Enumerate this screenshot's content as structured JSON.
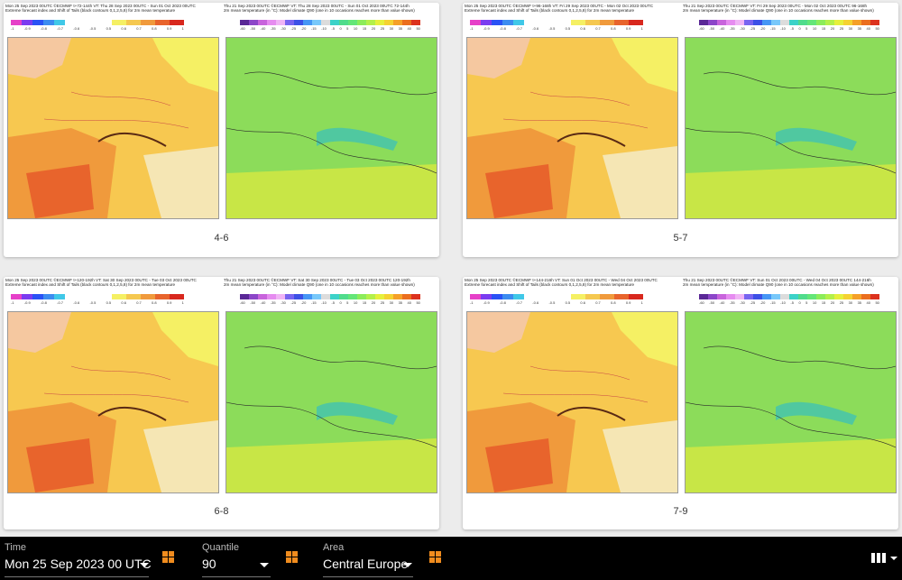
{
  "cards": [
    {
      "caption": "4-6",
      "left_header": "Mon 25 Sep 2023 00UTC ©ECMWF t+72-144h  VT: Thu 28 Sep 2023 00UTC - Sun 01 Oct 2023 00UTC\nExtreme forecast index and Shift of Tails (black contours 0,1,2,5,8) for 2m mean temperature",
      "right_header": "Thu 21 Sep 2023 00UTC ©ECMWF  VT: Thu 28 Sep 2023 00UTC - Sun 01 Oct 2023 00UTC   72-144h\n2m mean temperature (in °C): Model climate Q90 (one in 10 occasions reaches more than value shown)"
    },
    {
      "caption": "5-7",
      "left_header": "Mon 25 Sep 2023 00UTC ©ECMWF t+96-168h  VT: Fri 29 Sep 2023 00UTC - Mon 02 Oct 2023 00UTC\nExtreme forecast index and Shift of Tails (black contours 0,1,2,5,8) for 2m mean temperature",
      "right_header": "Thu 21 Sep 2023 00UTC ©ECMWF  VT: Fri 29 Sep 2023 00UTC - Mon 02 Oct 2023 00UTC   96-168h\n2m mean temperature (in °C): Model climate Q90 (one in 10 occasions reaches more than value shown)"
    },
    {
      "caption": "6-8",
      "left_header": "Mon 25 Sep 2023 00UTC ©ECMWF t+120-192h  VT: Sat 30 Sep 2023 00UTC - Tue 03 Oct 2023 00UTC\nExtreme forecast index and Shift of Tails (black contours 0,1,2,5,8) for 2m mean temperature",
      "right_header": "Thu 21 Sep 2023 00UTC ©ECMWF  VT: Sat 30 Sep 2023 00UTC - Tue 03 Oct 2023 00UTC   120-192h\n2m mean temperature (in °C): Model climate Q90 (one in 10 occasions reaches more than value shown)"
    },
    {
      "caption": "7-9",
      "left_header": "Mon 25 Sep 2023 00UTC ©ECMWF t+144-216h  VT: Sun 01 Oct 2023 00UTC - Wed 04 Oct 2023 00UTC\nExtreme forecast index and Shift of Tails (black contours 0,1,2,5,8) for 2m mean temperature",
      "right_header": "Thu 21 Sep 2023 00UTC ©ECMWF  VT: Sun 01 Oct 2023 00UTC - Wed 04 Oct 2023 00UTC   144-216h\n2m mean temperature (in °C): Model climate Q90 (one in 10 occasions reaches more than value shown)"
    }
  ],
  "efi_scale": {
    "ticks": [
      "-1",
      "-0.9",
      "-0.8",
      "-0.7",
      "-0.6",
      "-0.5",
      "0.5",
      "0.6",
      "0.7",
      "0.8",
      "0.9",
      "1"
    ],
    "cold_colors": [
      "#e640c8",
      "#7a3cf0",
      "#2a52f5",
      "#3c8cf0",
      "#40c8e8"
    ],
    "warm_colors": [
      "#f5f064",
      "#f5c850",
      "#f09a3c",
      "#e8642c",
      "#d8281e"
    ]
  },
  "q90_scale": {
    "ticks": [
      "-60",
      "-50",
      "-40",
      "-35",
      "-30",
      "-25",
      "-20",
      "-15",
      "-10",
      "-5",
      "0",
      "5",
      "10",
      "15",
      "20",
      "25",
      "30",
      "35",
      "40",
      "50"
    ],
    "colors": [
      "#5a2896",
      "#8c46c8",
      "#c864dc",
      "#e68cf0",
      "#f0b4f5",
      "#7864f0",
      "#3c50e6",
      "#4696f5",
      "#78c8fa",
      "#dcdcdc",
      "#3cd2c8",
      "#50dc8c",
      "#64e678",
      "#8cec5a",
      "#b4f04a",
      "#e6f03c",
      "#f5d232",
      "#f5a028",
      "#eb6e1e",
      "#dc321e"
    ]
  },
  "toolbar": {
    "time_label": "Time",
    "time_value": "Mon 25 Sep 2023 00 UTC",
    "quantile_label": "Quantile",
    "quantile_value": "90",
    "area_label": "Area",
    "area_value": "Central Europe"
  }
}
